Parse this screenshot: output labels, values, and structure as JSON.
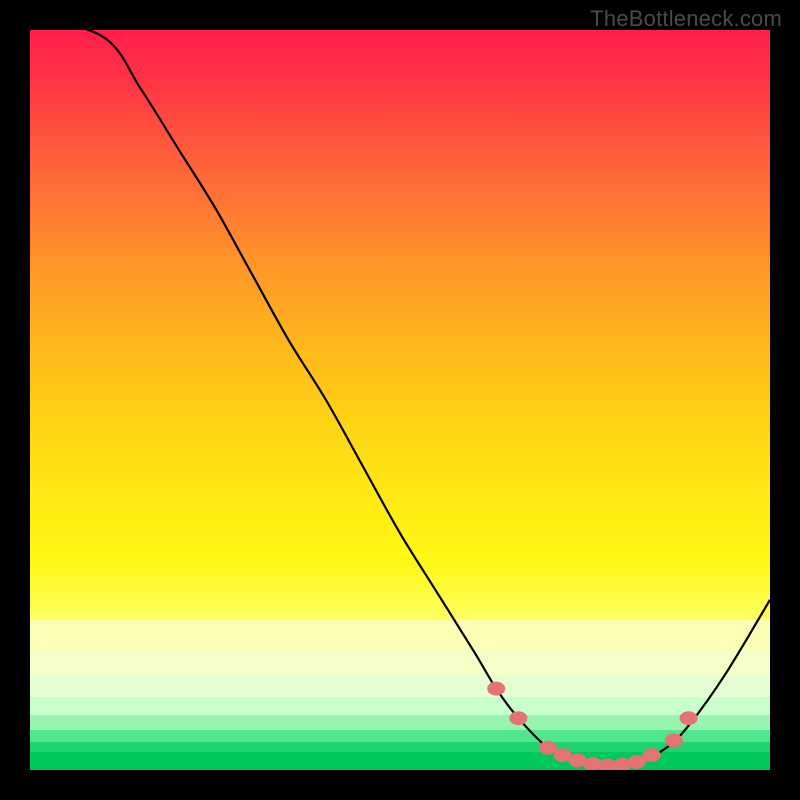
{
  "watermark": "TheBottleneck.com",
  "chart_data": {
    "type": "line",
    "title": "",
    "xlabel": "",
    "ylabel": "",
    "xlim": [
      0,
      100
    ],
    "ylim": [
      0,
      100
    ],
    "curve": [
      {
        "x": 0,
        "y": 102
      },
      {
        "x": 10,
        "y": 99
      },
      {
        "x": 15,
        "y": 92
      },
      {
        "x": 20,
        "y": 84
      },
      {
        "x": 25,
        "y": 76
      },
      {
        "x": 30,
        "y": 67
      },
      {
        "x": 35,
        "y": 58
      },
      {
        "x": 40,
        "y": 50
      },
      {
        "x": 45,
        "y": 41
      },
      {
        "x": 50,
        "y": 32
      },
      {
        "x": 55,
        "y": 24
      },
      {
        "x": 60,
        "y": 16
      },
      {
        "x": 63,
        "y": 11
      },
      {
        "x": 66,
        "y": 7
      },
      {
        "x": 70,
        "y": 3
      },
      {
        "x": 74,
        "y": 1
      },
      {
        "x": 78,
        "y": 0.5
      },
      {
        "x": 82,
        "y": 1
      },
      {
        "x": 86,
        "y": 3
      },
      {
        "x": 89,
        "y": 6
      },
      {
        "x": 94,
        "y": 13
      },
      {
        "x": 100,
        "y": 23
      }
    ],
    "markers": [
      {
        "x": 63,
        "y": 11
      },
      {
        "x": 66,
        "y": 7
      },
      {
        "x": 70,
        "y": 3
      },
      {
        "x": 72,
        "y": 2
      },
      {
        "x": 74,
        "y": 1.3
      },
      {
        "x": 76,
        "y": 0.8
      },
      {
        "x": 78,
        "y": 0.6
      },
      {
        "x": 80,
        "y": 0.7
      },
      {
        "x": 82,
        "y": 1.1
      },
      {
        "x": 84,
        "y": 2
      },
      {
        "x": 87,
        "y": 4
      },
      {
        "x": 89,
        "y": 7
      }
    ],
    "background_gradient": {
      "colors_top_to_bottom": [
        "#ff1e4a",
        "#ff5a3c",
        "#ff9628",
        "#ffd214",
        "#fff814",
        "#faffb4",
        "#c8ffcd",
        "#50e68c",
        "#00c85a"
      ]
    }
  }
}
